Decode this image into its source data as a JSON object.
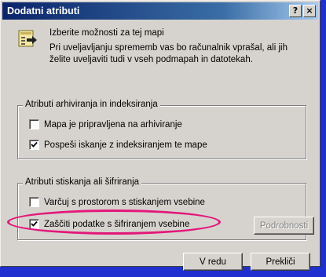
{
  "window": {
    "title": "Dodatni atributi",
    "help_glyph": "?",
    "close_glyph": "×"
  },
  "info": {
    "heading": "Izberite možnosti za tej mapi",
    "description": "Pri uveljavljanju sprememb vas bo računalnik vprašal, ali jih želite uveljaviti tudi v vseh podmapah in datotekah."
  },
  "archive_group": {
    "label": "Atributi arhiviranja in indeksiranja",
    "items": [
      {
        "label": "Mapa je pripravljena na arhiviranje",
        "checked": false
      },
      {
        "label": "Pospeši iskanje z indeksiranjem te mape",
        "checked": true
      }
    ]
  },
  "compress_group": {
    "label": "Atributi stiskanja ali šifriranja",
    "items": [
      {
        "label": "Varčuj s prostorom s stiskanjem vsebine",
        "checked": false
      },
      {
        "label": "Zaščiti podatke s šifriranjem vsebine",
        "checked": true
      }
    ],
    "details_label": "Podrobnosti"
  },
  "buttons": {
    "ok_label": "V redu",
    "cancel_label": "Prekliči"
  },
  "colors": {
    "highlight": "#e3177a",
    "titlebar": "#0a246a",
    "background": "#1f2fd0"
  }
}
